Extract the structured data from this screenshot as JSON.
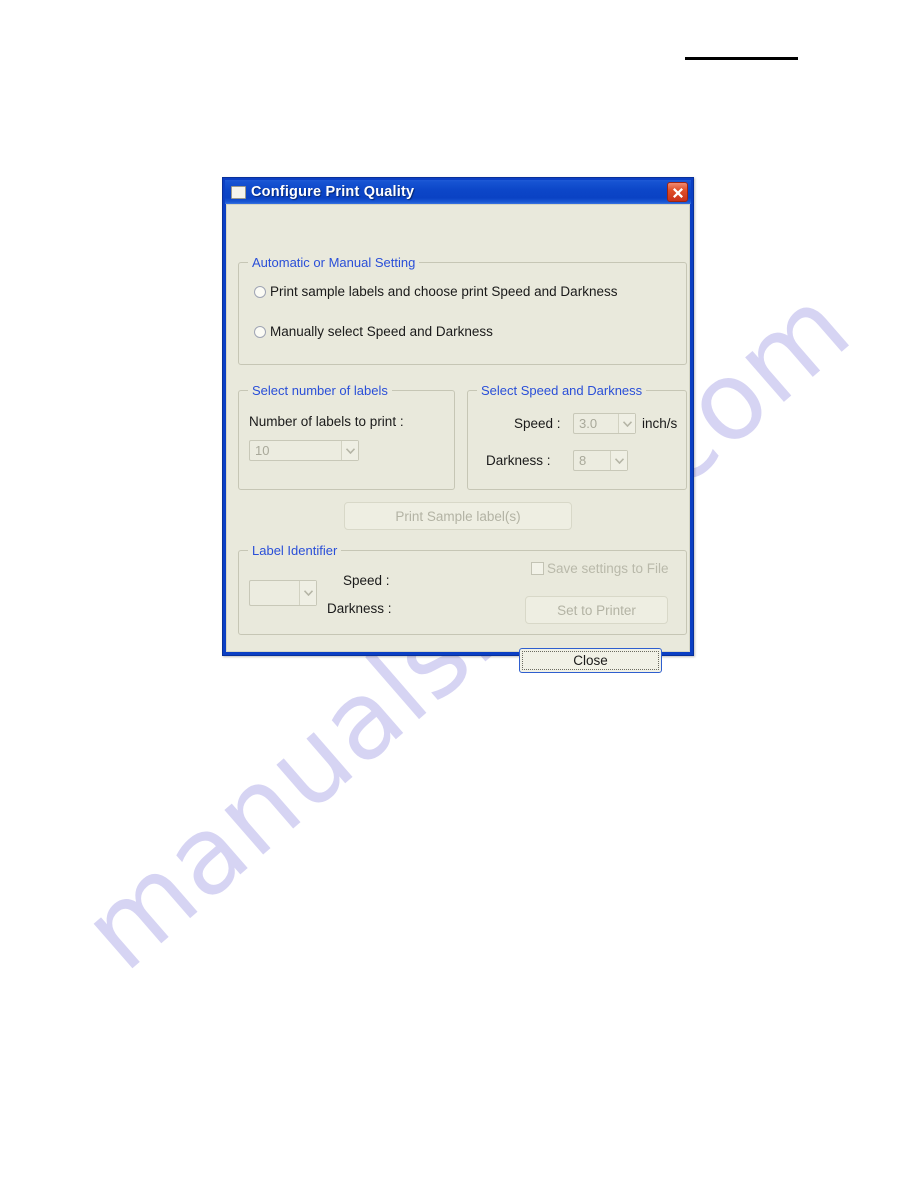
{
  "page": {
    "watermark_text": "manualshive.com",
    "header_rule": "horizontal-rule"
  },
  "dialog": {
    "title": "Configure Print Quality",
    "window_icon": "window-icon",
    "close_icon": "close-icon",
    "groups": {
      "auto_manual": {
        "legend": "Automatic or Manual Setting",
        "options": [
          {
            "label": "Print sample labels and choose print Speed and Darkness",
            "selected": false
          },
          {
            "label": "Manually select Speed and Darkness",
            "selected": false
          }
        ]
      },
      "number_of_labels": {
        "legend": "Select number of labels",
        "field_label": "Number of labels to print :",
        "value": "10",
        "enabled": false
      },
      "speed_and_darkness": {
        "legend": "Select Speed and Darkness",
        "speed_label": "Speed :",
        "speed_value": "3.0",
        "speed_unit": "inch/s",
        "darkness_label": "Darkness :",
        "darkness_value": "8",
        "enabled": false
      },
      "label_identifier": {
        "legend": "Label Identifier",
        "identifier_value": "",
        "speed_label": "Speed :",
        "darkness_label": "Darkness :",
        "save_settings_label": "Save settings to File",
        "save_settings_checked": false,
        "set_to_printer_label": "Set to Printer",
        "set_to_printer_enabled": false
      }
    },
    "print_sample_label": "Print Sample label(s)",
    "print_sample_enabled": false,
    "close_label": "Close"
  },
  "colors": {
    "title_bar": "#0c46c8",
    "dialog_face": "#e9e9dc",
    "legend_text": "#2a4fd8",
    "close_button_red": "#c8301a",
    "disabled_text": "#b3b3a4",
    "watermark": "#c9c6ef"
  }
}
